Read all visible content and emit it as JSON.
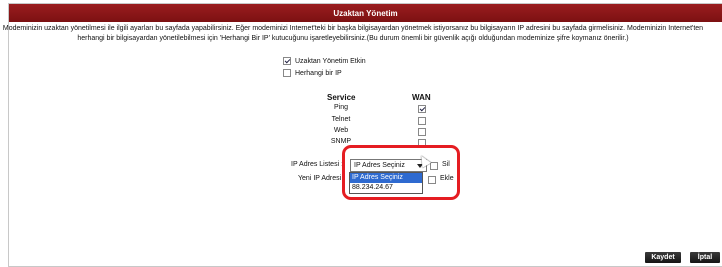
{
  "title": "Uzaktan Yönetim",
  "description_line1": "Modeminizin uzaktan yönetilmesi ile ilgili ayarları bu sayfada yapabilirsiniz. Eğer modeminizi Internet'teki bir başka bilgisayardan yönetmek istiyorsanız bu bilgisayarın IP adresini bu sayfada girmelisiniz. Modeminizin Internet'ten",
  "description_line2": "herhangi bir bilgisayardan yönetilebilmesi için 'Herhangi Bir IP' kutucuğunu işaretleyebilirsiniz.(Bu durum önemli bir güvenlik açığı olduğundan modeminize şifre koymanız önerilir.)",
  "options": {
    "remote_enabled": {
      "label": "Uzaktan Yönetim Etkin",
      "checked": true
    },
    "any_ip": {
      "label": "Herhangi bir IP",
      "checked": false
    }
  },
  "services": {
    "col_service": "Service",
    "col_wan": "WAN",
    "rows": [
      {
        "name": "Ping",
        "checked": true
      },
      {
        "name": "Telnet",
        "checked": false
      },
      {
        "name": "Web",
        "checked": false
      },
      {
        "name": "SNMP",
        "checked": false
      }
    ]
  },
  "ip_list": {
    "label": "IP Adres Listesi :",
    "selected": "IP Adres Seçiniz",
    "options": [
      "IP Adres Seçiniz",
      "88.234.24.67"
    ],
    "delete_label": "Sil"
  },
  "new_ip": {
    "label": "Yeni IP Adresi :",
    "add_label": "Ekle"
  },
  "buttons": {
    "save": "Kaydet",
    "cancel": "İptal"
  }
}
